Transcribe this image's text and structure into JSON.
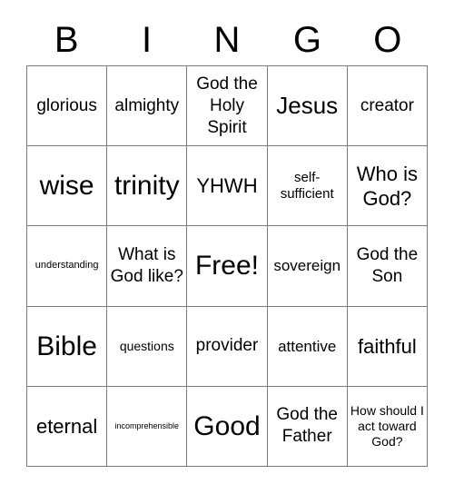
{
  "card": {
    "title": "BINGO card",
    "headers": [
      "B",
      "I",
      "N",
      "G",
      "O"
    ],
    "free_space_label": "Free!",
    "grid_size": "5x5",
    "rows": [
      [
        {
          "text": "glorious",
          "size": "xl"
        },
        {
          "text": "almighty",
          "size": "xl"
        },
        {
          "text": "God the Holy Spirit",
          "size": "xl"
        },
        {
          "text": "Jesus",
          "size": "3xl"
        },
        {
          "text": "creator",
          "size": "xl"
        }
      ],
      [
        {
          "text": "wise",
          "size": "4xl"
        },
        {
          "text": "trinity",
          "size": "4xl"
        },
        {
          "text": "YHWH",
          "size": "2xl"
        },
        {
          "text": "self-sufficient",
          "size": "md"
        },
        {
          "text": "Who is God?",
          "size": "2xl"
        }
      ],
      [
        {
          "text": "understanding",
          "size": "xs"
        },
        {
          "text": "What is God like?",
          "size": "xl"
        },
        {
          "text": "Free!",
          "size": "4xl"
        },
        {
          "text": "sovereign",
          "size": "lg"
        },
        {
          "text": "God the Son",
          "size": "xl"
        }
      ],
      [
        {
          "text": "Bible",
          "size": "4xl"
        },
        {
          "text": "questions",
          "size": "sm"
        },
        {
          "text": "provider",
          "size": "xl"
        },
        {
          "text": "attentive",
          "size": "lg"
        },
        {
          "text": "faithful",
          "size": "2xl"
        }
      ],
      [
        {
          "text": "eternal",
          "size": "2xl"
        },
        {
          "text": "incomprehensible",
          "size": "xxs"
        },
        {
          "text": "Good",
          "size": "4xl"
        },
        {
          "text": "God the Father",
          "size": "xl"
        },
        {
          "text": "How should I act toward God?",
          "size": "sm"
        }
      ]
    ]
  },
  "colors": {
    "background": "#ffffff",
    "text": "#000000",
    "grid_line": "#7d7d7d"
  }
}
